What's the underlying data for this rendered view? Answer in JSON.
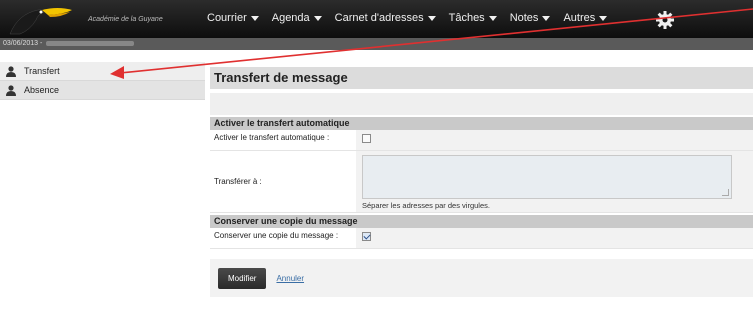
{
  "header": {
    "org_name": "Académie de la Guyane",
    "menu": [
      {
        "label": "Courrier"
      },
      {
        "label": "Agenda"
      },
      {
        "label": "Carnet d'adresses"
      },
      {
        "label": "Tâches"
      },
      {
        "label": "Notes"
      },
      {
        "label": "Autres"
      }
    ],
    "settings_icon": "gear-icon"
  },
  "subbar": {
    "date": "03/06/2013 -"
  },
  "sidebar": {
    "items": [
      {
        "label": "Transfert",
        "icon": "person-icon"
      },
      {
        "label": "Absence",
        "icon": "person-icon"
      }
    ]
  },
  "main": {
    "title": "Transfert de message",
    "section_forward": {
      "heading": "Activer le transfert automatique",
      "enable_label": "Activer le transfert automatique :",
      "enable_checked": false,
      "forward_to_label": "Transférer à :",
      "forward_to_value": "",
      "forward_hint": "Séparer les adresses par des virgules."
    },
    "section_copy": {
      "heading": "Conserver une copie du message",
      "keep_copy_label": "Conserver une copie du message :",
      "keep_copy_checked": true
    },
    "actions": {
      "modify_label": "Modifier",
      "cancel_label": "Annuler"
    }
  },
  "annotation_color": "#e03030"
}
